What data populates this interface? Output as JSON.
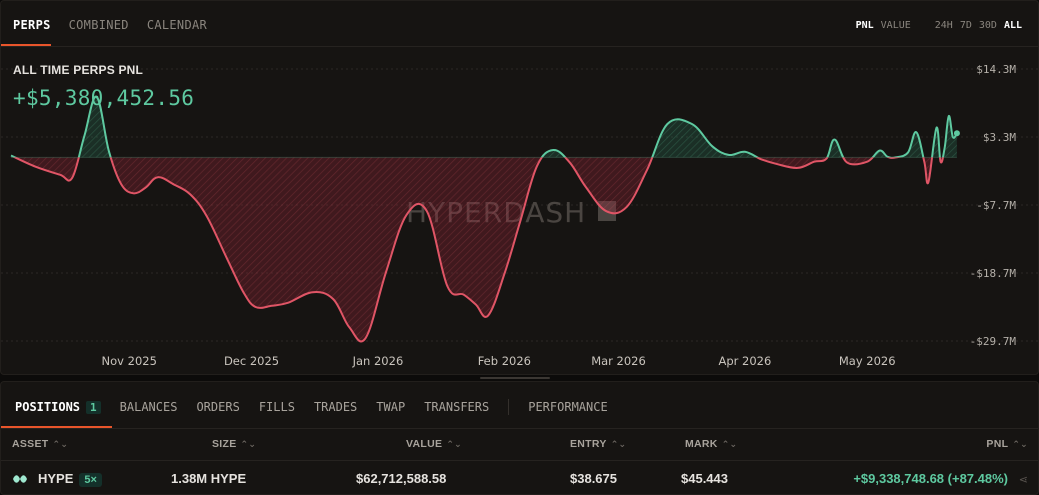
{
  "top_tabs": [
    "PERPS",
    "COMBINED",
    "CALENDAR"
  ],
  "active_top_tab": "PERPS",
  "mode_toggles": [
    "PNL",
    "VALUE"
  ],
  "range_toggles": [
    "24H",
    "7D",
    "30D",
    "ALL"
  ],
  "active_mode": "PNL",
  "active_range": "ALL",
  "header": {
    "title": "ALL TIME PERPS PNL",
    "value": "+$5,380,452.56"
  },
  "watermark": "HYPERDASH",
  "colors": {
    "positive": "#5ec9a0",
    "negative": "#e05566",
    "accent": "#e8552b",
    "background": "#161412"
  },
  "chart_data": {
    "type": "area",
    "y_tick_labels": [
      "$14.3M",
      "$3.3M",
      "-$7.7M",
      "-$18.7M",
      "-$29.7M"
    ],
    "y_ticks": [
      14.3,
      3.3,
      -7.7,
      -18.7,
      -29.7
    ],
    "ylim": [
      -29.7,
      14.3
    ],
    "baseline": 0,
    "x_tick_labels": [
      "Nov 2025",
      "Dec 2025",
      "Jan 2026",
      "Feb 2026",
      "Mar 2026",
      "Apr 2026",
      "May 2026"
    ],
    "x_tick_dates": [
      "2025-11-01",
      "2025-12-01",
      "2026-01-01",
      "2026-02-01",
      "2026-03-01",
      "2026-04-01",
      "2026-05-01"
    ],
    "x_range": [
      "2025-10-03",
      "2026-05-24"
    ],
    "grid": "horizontal dotted",
    "series": [
      {
        "values_unit": "USD millions",
        "x": [
          "2025-10-03",
          "2025-10-09",
          "2025-10-15",
          "2025-10-18",
          "2025-10-21",
          "2025-10-24",
          "2025-10-27",
          "2025-10-30",
          "2025-11-02",
          "2025-11-05",
          "2025-11-08",
          "2025-11-12",
          "2025-11-16",
          "2025-11-20",
          "2025-11-25",
          "2025-11-29",
          "2025-12-02",
          "2025-12-06",
          "2025-12-10",
          "2025-12-16",
          "2025-12-21",
          "2025-12-25",
          "2025-12-29",
          "2026-01-03",
          "2026-01-08",
          "2026-01-13",
          "2026-01-18",
          "2026-01-22",
          "2026-01-25",
          "2026-01-28",
          "2026-02-01",
          "2026-02-05",
          "2026-02-09",
          "2026-02-13",
          "2026-02-17",
          "2026-02-21",
          "2026-02-26",
          "2026-03-03",
          "2026-03-08",
          "2026-03-13",
          "2026-03-19",
          "2026-03-24",
          "2026-03-28",
          "2026-04-01",
          "2026-04-05",
          "2026-04-09",
          "2026-04-14",
          "2026-04-18",
          "2026-04-21",
          "2026-04-23",
          "2026-04-26",
          "2026-05-01",
          "2026-05-04",
          "2026-05-06",
          "2026-05-08",
          "2026-05-11",
          "2026-05-13",
          "2026-05-15",
          "2026-05-16",
          "2026-05-18",
          "2026-05-19",
          "2026-05-20",
          "2026-05-21",
          "2026-05-22",
          "2026-05-23"
        ],
        "values": [
          0.3,
          -1.5,
          -2.8,
          -3.3,
          3.5,
          9.8,
          1.0,
          -4.3,
          -5.8,
          -4.9,
          -3.2,
          -4.4,
          -6.0,
          -9.5,
          -16.4,
          -21.8,
          -24.2,
          -24.0,
          -23.5,
          -21.8,
          -22.9,
          -27.5,
          -29.2,
          -18.5,
          -9.3,
          -8.7,
          -20.8,
          -22.2,
          -23.8,
          -25.6,
          -18.9,
          -10.1,
          -1.4,
          1.2,
          -0.8,
          -4.8,
          -8.7,
          -8.0,
          -2.0,
          5.4,
          5.4,
          1.8,
          0.4,
          0.9,
          -0.3,
          -1.1,
          -1.7,
          -0.7,
          -0.2,
          2.9,
          -0.8,
          -0.7,
          1.1,
          0.1,
          0.0,
          0.8,
          4.1,
          -0.7,
          -4.0,
          4.8,
          -0.7,
          1.6,
          6.7,
          3.3,
          3.9
        ]
      }
    ]
  },
  "bottom_tabs": [
    {
      "label": "POSITIONS",
      "count": "1"
    },
    {
      "label": "BALANCES"
    },
    {
      "label": "ORDERS"
    },
    {
      "label": "FILLS"
    },
    {
      "label": "TRADES"
    },
    {
      "label": "TWAP"
    },
    {
      "label": "TRANSFERS"
    },
    {
      "label": "PERFORMANCE"
    }
  ],
  "table": {
    "columns": [
      "ASSET",
      "SIZE",
      "VALUE",
      "ENTRY",
      "MARK",
      "PNL"
    ],
    "rows": [
      {
        "asset": "HYPE",
        "leverage": "5×",
        "size": "1.38M HYPE",
        "value": "$62,712,588.58",
        "entry": "$38.675",
        "mark": "$45.443",
        "pnl": "+$9,338,748.68 (+87.48%)"
      }
    ]
  }
}
